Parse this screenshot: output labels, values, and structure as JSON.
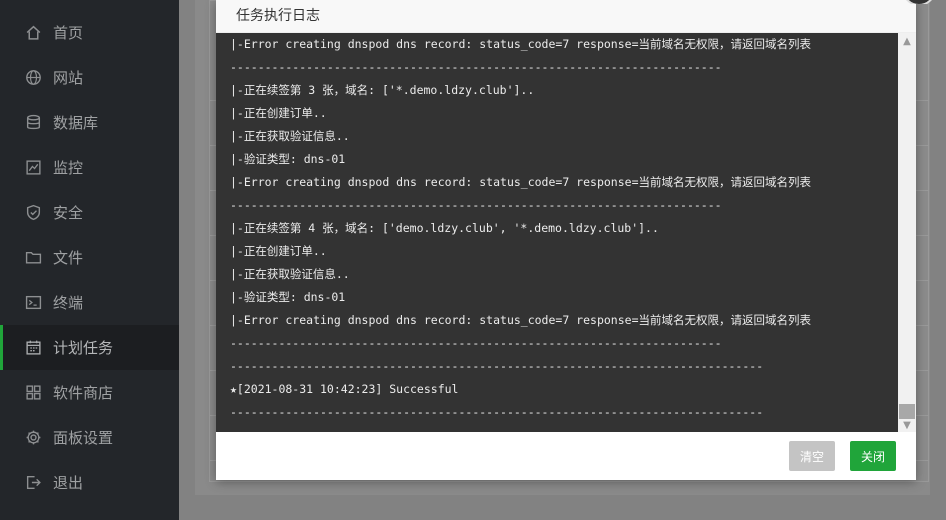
{
  "sidebar": {
    "items": [
      {
        "label": "首页",
        "icon": "home-icon"
      },
      {
        "label": "网站",
        "icon": "globe-icon"
      },
      {
        "label": "数据库",
        "icon": "database-icon"
      },
      {
        "label": "监控",
        "icon": "monitor-icon"
      },
      {
        "label": "安全",
        "icon": "shield-icon"
      },
      {
        "label": "文件",
        "icon": "folder-icon"
      },
      {
        "label": "终端",
        "icon": "terminal-icon"
      },
      {
        "label": "计划任务",
        "icon": "calendar-icon"
      },
      {
        "label": "软件商店",
        "icon": "grid-icon"
      },
      {
        "label": "面板设置",
        "icon": "gear-icon"
      },
      {
        "label": "退出",
        "icon": "logout-icon"
      }
    ],
    "active_index": 7,
    "active_accent": "#20a53a"
  },
  "modal": {
    "title": "任务执行日志",
    "log": [
      "|-Error creating dnspod dns record: status_code=7 response=当前域名无权限，请返回域名列表",
      "-----------------------------------------------------------------------",
      "|-正在续签第 3 张，域名: ['*.demo.ldzy.club']..",
      "|-正在创建订单..",
      "|-正在获取验证信息..",
      "|-验证类型: dns-01",
      "|-Error creating dnspod dns record: status_code=7 response=当前域名无权限，请返回域名列表",
      "-----------------------------------------------------------------------",
      "|-正在续签第 4 张，域名: ['demo.ldzy.club', '*.demo.ldzy.club']..",
      "|-正在创建订单..",
      "|-正在获取验证信息..",
      "|-验证类型: dns-01",
      "|-Error creating dnspod dns record: status_code=7 response=当前域名无权限，请返回域名列表",
      "-----------------------------------------------------------------------",
      "-----------------------------------------------------------------------------",
      "★[2021-08-31 10:42:23] Successful",
      "-----------------------------------------------------------------------------"
    ],
    "buttons": {
      "clear": "清空",
      "close": "关闭"
    }
  }
}
